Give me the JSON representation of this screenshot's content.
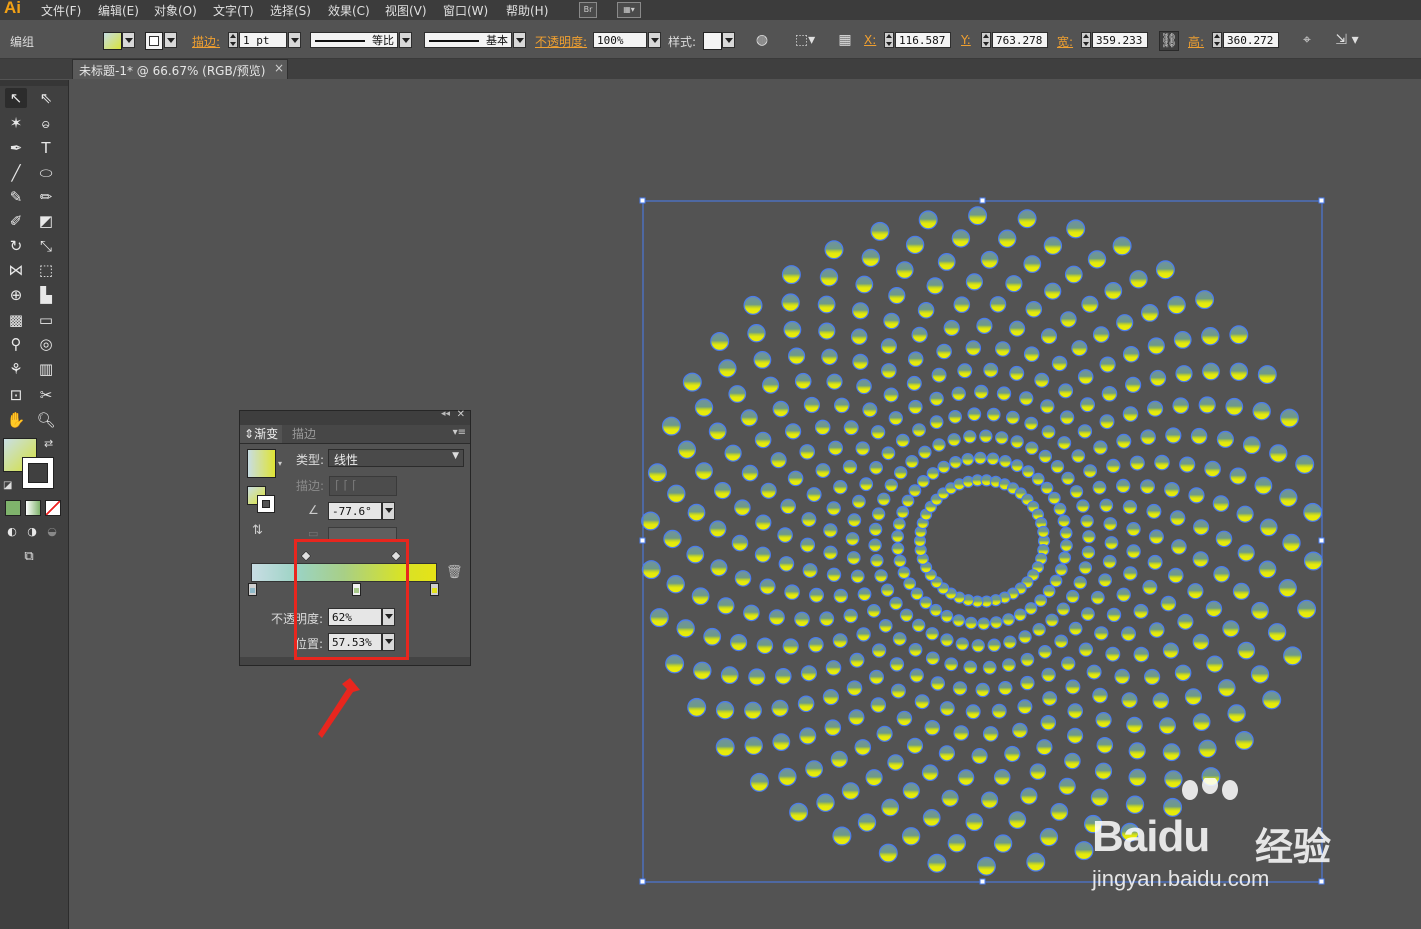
{
  "app": {
    "logo": "Ai",
    "bridge_label": "Br"
  },
  "menu": [
    "文件(F)",
    "编辑(E)",
    "对象(O)",
    "文字(T)",
    "选择(S)",
    "效果(C)",
    "视图(V)",
    "窗口(W)",
    "帮助(H)"
  ],
  "control": {
    "mode": "编组",
    "stroke_label": "描边:",
    "stroke_weight": "1 pt",
    "stroke_profile": "等比",
    "brush": "基本",
    "opacity_label": "不透明度:",
    "opacity": "100%",
    "style_label": "样式:",
    "x_label": "X:",
    "x": "116.587",
    "y_label": "Y:",
    "y": "763.278",
    "w_label": "宽:",
    "w": "359.233",
    "h_label": "高:",
    "h": "360.272"
  },
  "document": {
    "tab": "未标题-1* @ 66.67% (RGB/预览)",
    "close": "×"
  },
  "gradient_panel": {
    "tab_gradient": "渐变",
    "tab_stroke": "描边",
    "type_label": "类型:",
    "type_value": "线性",
    "stroke_label": "描边:",
    "angle": "-77.6°",
    "opacity_label": "不透明度:",
    "opacity_value": "62%",
    "location_label": "位置:",
    "location_value": "57.53%",
    "stop_colors": [
      "#8fb9c8",
      "#a8c98a",
      "#e3e21a"
    ]
  },
  "watermark": {
    "brand": "Bai",
    "brand2": "du",
    "cn": "经验",
    "url": "jingyan.baidu.com"
  },
  "colors": {
    "accent_orange": "#f0a030",
    "highlight_red": "#e8261e",
    "selection_blue": "#4a7cf0",
    "art_top": "#6d91a6",
    "art_bottom": "#e4e90d"
  }
}
